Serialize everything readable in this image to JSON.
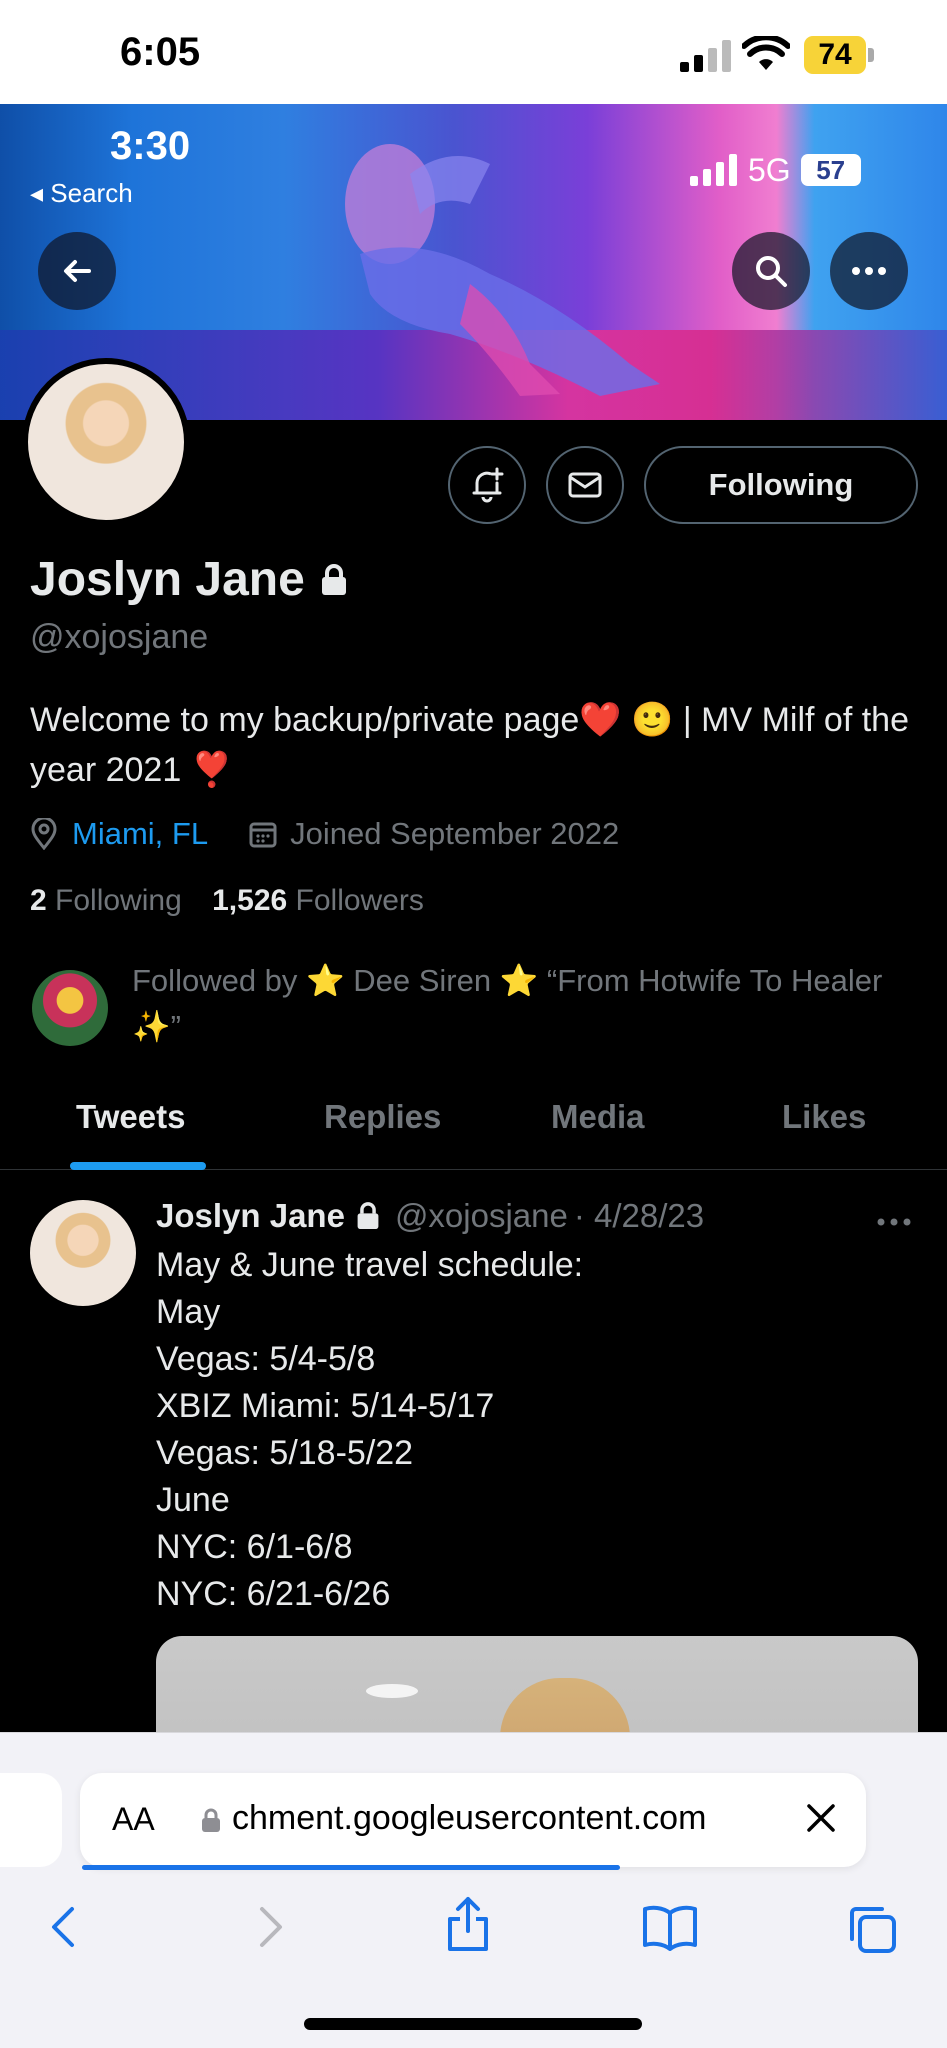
{
  "device": {
    "time": "6:05",
    "battery": "74"
  },
  "inner_status": {
    "time": "3:30",
    "back_label": "◂ Search",
    "network": "5G",
    "battery": "57"
  },
  "profile": {
    "name": "Joslyn Jane",
    "handle": "@xojosjane",
    "bio": "Welcome to my backup/private page❤️ 🙂 | MV Milf of the year 2021 ❣️",
    "location": "Miami, FL",
    "joined": "Joined September 2022",
    "following_count": "2",
    "following_label": "Following",
    "followers_count": "1,526",
    "followers_label": "Followers",
    "followed_by": "Followed by ⭐️ Dee Siren ⭐️ “From Hotwife To Healer ✨”",
    "following_button": "Following"
  },
  "tabs": [
    {
      "label": "Tweets",
      "active": true
    },
    {
      "label": "Replies",
      "active": false
    },
    {
      "label": "Media",
      "active": false
    },
    {
      "label": "Likes",
      "active": false
    }
  ],
  "tweet": {
    "name": "Joslyn Jane",
    "handle": "@xojosjane",
    "date": "· 4/28/23",
    "lines": [
      "May & June travel schedule:",
      "May",
      "Vegas: 5/4-5/8",
      "XBIZ Miami: 5/14-5/17",
      "Vegas: 5/18-5/22",
      "June",
      "NYC: 6/1-6/8",
      "NYC: 6/21-6/26"
    ]
  },
  "browser": {
    "aa_label": "AA",
    "url": "chment.googleusercontent.com",
    "load_progress": 0.56
  },
  "colors": {
    "accent": "#1d9bf0",
    "background": "#000000",
    "secondary_text": "#71767b",
    "battery_low": "#f7d338",
    "safari_blue": "#1a73e8"
  }
}
